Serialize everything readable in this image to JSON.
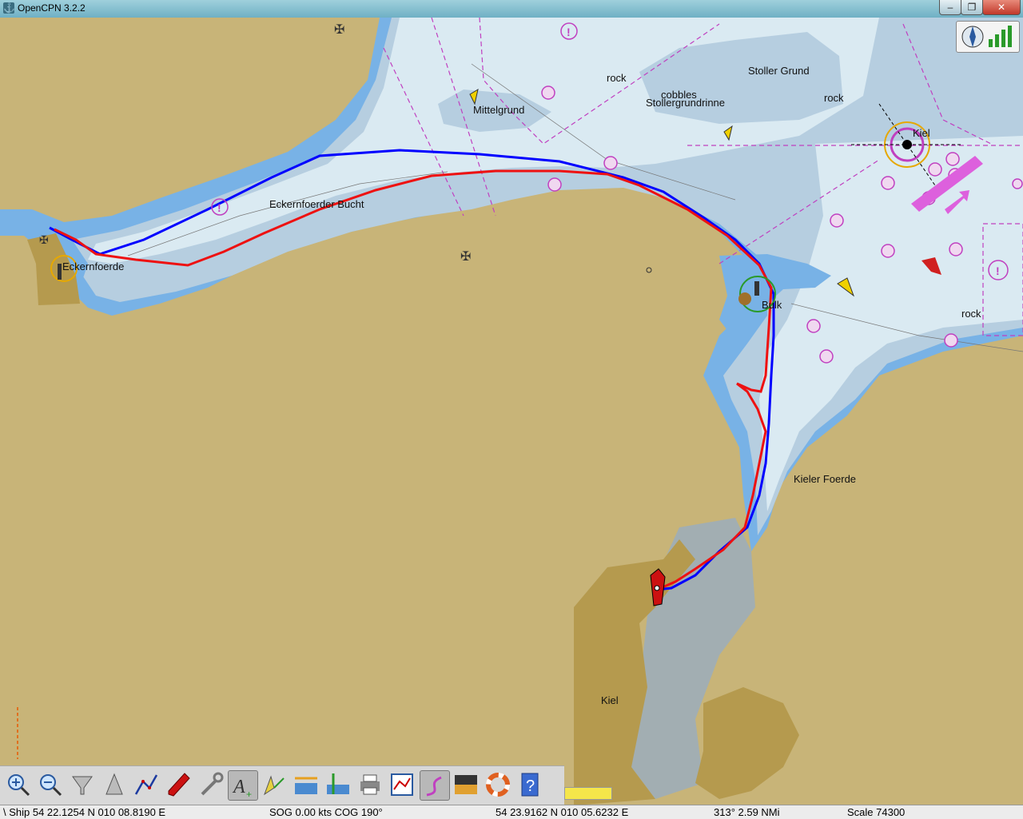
{
  "window": {
    "title": "OpenCPN 3.2.2",
    "min_glyph": "–",
    "max_glyph": "❐",
    "close_glyph": "✕"
  },
  "chart": {
    "labels": {
      "rock_1": "rock",
      "cobbles": "cobbles",
      "stoller_grund": "Stoller Grund",
      "rock_2": "rock",
      "stollergrundrinne": "Stollergrundrinne",
      "mittelgrund": "Mittelgrund",
      "kiel_light": "Kiel",
      "eckernfoerder_bucht": "Eckernfoerder Bucht",
      "eckernfoerde": "Eckernfoerde",
      "bulk": "Bulk",
      "rock_3": "rock",
      "kieler_foerde": "Kieler Foerde",
      "kiel_city": "Kiel"
    },
    "colors": {
      "land": "#c8b478",
      "urban": "#b59a4e",
      "shallow": "#78b2e6",
      "medium": "#b6cee0",
      "deep": "#daeaf2",
      "harbour": "#a2aeb2",
      "route": "#0000ff",
      "track": "#ee1111",
      "nav": "#c040c0"
    }
  },
  "toolbar": {
    "buttons": [
      {
        "name": "zoom-in-button",
        "icon": "zoom-in-icon"
      },
      {
        "name": "zoom-out-button",
        "icon": "zoom-out-icon"
      },
      {
        "name": "scale-in-button",
        "icon": "funnel-icon"
      },
      {
        "name": "scale-out-button",
        "icon": "cone-icon"
      },
      {
        "name": "route-button",
        "icon": "route-icon"
      },
      {
        "name": "auto-follow-button",
        "icon": "ship-icon"
      },
      {
        "name": "settings-button",
        "icon": "wrench-icon"
      },
      {
        "name": "text-button",
        "icon": "text-icon"
      },
      {
        "name": "current-button",
        "icon": "current-icon"
      },
      {
        "name": "tides-button",
        "icon": "tides-icon"
      },
      {
        "name": "tide-height-button",
        "icon": "tide-height-icon"
      },
      {
        "name": "print-button",
        "icon": "printer-icon"
      },
      {
        "name": "route-manager-button",
        "icon": "route-manager-icon"
      },
      {
        "name": "track-button",
        "icon": "track-icon"
      },
      {
        "name": "color-scheme-button",
        "icon": "color-scheme-icon"
      },
      {
        "name": "mob-button",
        "icon": "lifebuoy-icon"
      },
      {
        "name": "help-button",
        "icon": "help-icon"
      }
    ],
    "active": [
      "text-button",
      "track-button"
    ]
  },
  "statusbar": {
    "ship": "\\ Ship 54 22.1254 N   010 08.8190 E",
    "sog": "SOG 0.00 kts   COG 190°",
    "cursor": "54 23.9162 N   010 05.6232 E",
    "bearing": "313°   2.59 NMi",
    "scale": "Scale 74300"
  }
}
